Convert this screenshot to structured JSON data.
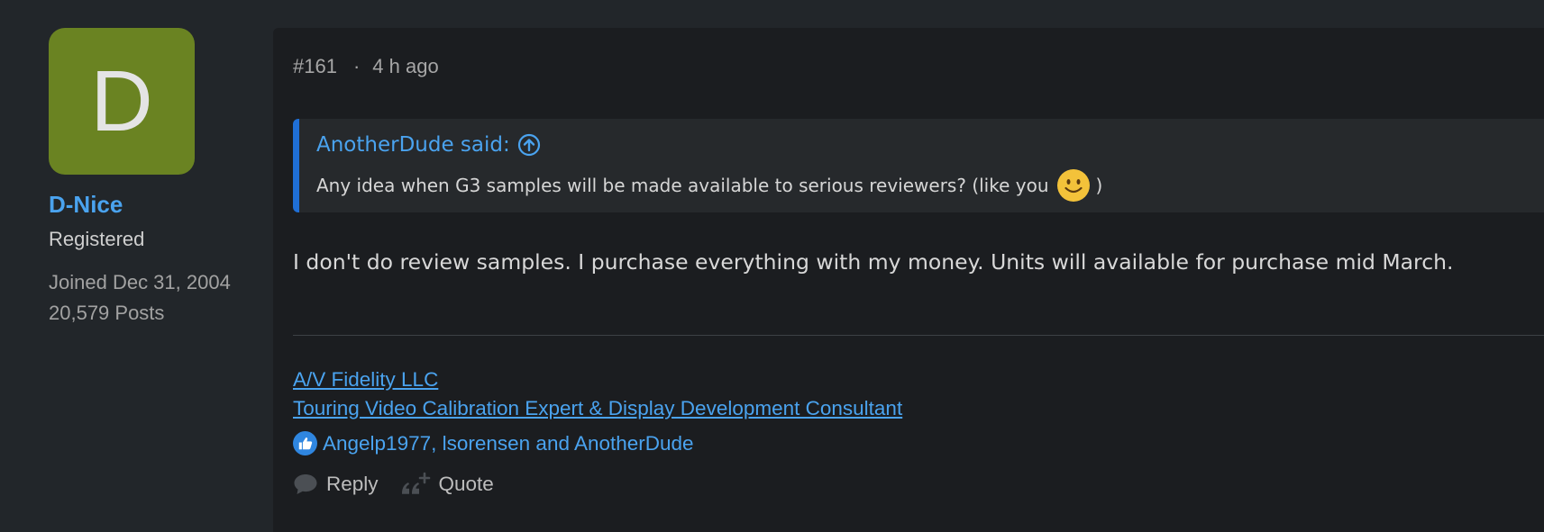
{
  "user": {
    "avatar_letter": "D",
    "username": "D-Nice",
    "role": "Registered",
    "joined": "Joined Dec 31, 2004",
    "posts": "20,579 Posts"
  },
  "post": {
    "number": "#161",
    "separator": "·",
    "time": "4 h ago",
    "quote": {
      "author": "AnotherDude said:",
      "text_before": "Any idea when G3 samples will be made available to serious reviewers? (like you",
      "text_after": ")"
    },
    "body": "I don't do review samples. I purchase everything with my money. Units will available for purchase mid March.",
    "signature": {
      "line1": "A/V Fidelity LLC",
      "line2": "Touring Video Calibration Expert & Display Development Consultant"
    },
    "likes": "Angelp1977, lsorensen and AnotherDude",
    "actions": {
      "reply": "Reply",
      "quote": "Quote"
    }
  },
  "colors": {
    "accent": "#4aa3ef",
    "avatar_bg": "#6a8322",
    "quote_bar": "#1f6fd6"
  }
}
